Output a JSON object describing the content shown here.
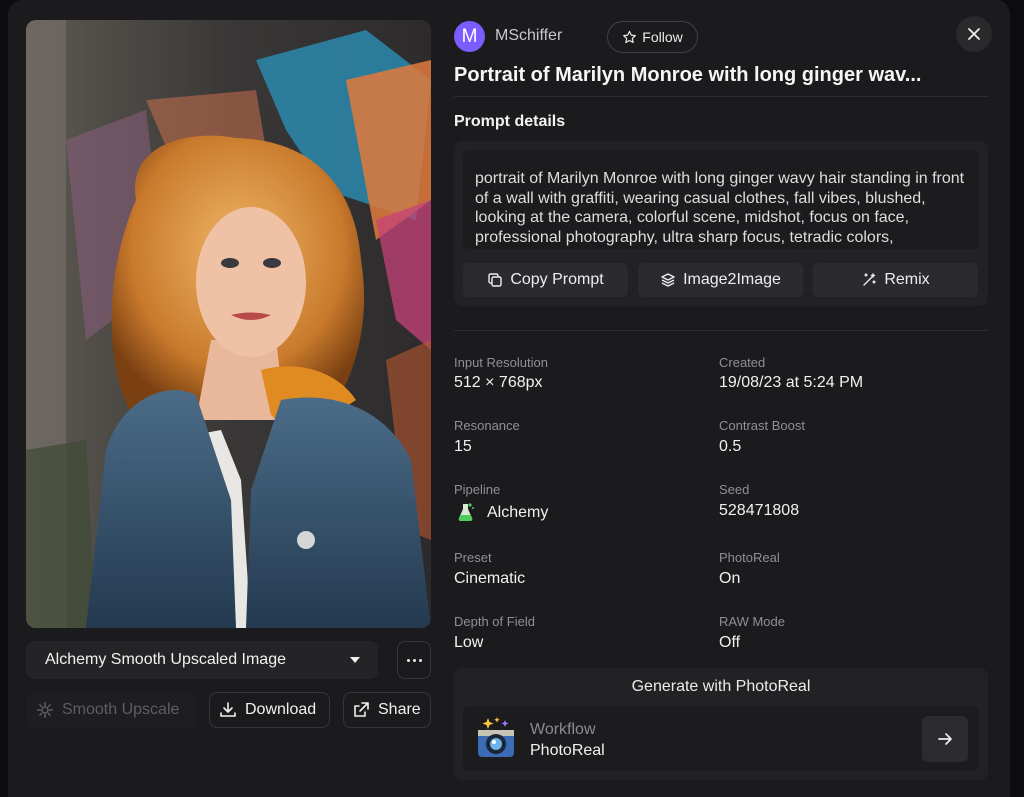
{
  "image": {
    "variant_label": "Alchemy Smooth Upscaled Image"
  },
  "actions": {
    "smooth_upscale": "Smooth Upscale",
    "download": "Download",
    "share": "Share"
  },
  "author": {
    "initial": "M",
    "name": "MSchiffer",
    "follow_label": "Follow"
  },
  "title": "Portrait of Marilyn Monroe with long ginger wav...",
  "prompt": {
    "heading": "Prompt details",
    "text": "portrait of Marilyn Monroe with long ginger wavy hair standing in front of a wall with graffiti, wearing casual clothes, fall vibes, blushed, looking at the camera, colorful scene, midshot, focus on face, professional photography, ultra sharp focus, tetradic colors,",
    "copy_label": "Copy Prompt",
    "img2img_label": "Image2Image",
    "remix_label": "Remix"
  },
  "details": {
    "input_resolution": {
      "label": "Input Resolution",
      "value": "512 × 768px"
    },
    "created": {
      "label": "Created",
      "value": "19/08/23 at 5:24 PM"
    },
    "resonance": {
      "label": "Resonance",
      "value": "15"
    },
    "contrast_boost": {
      "label": "Contrast Boost",
      "value": "0.5"
    },
    "pipeline": {
      "label": "Pipeline",
      "value": "Alchemy"
    },
    "seed": {
      "label": "Seed",
      "value": "528471808"
    },
    "preset": {
      "label": "Preset",
      "value": "Cinematic"
    },
    "photoreal": {
      "label": "PhotoReal",
      "value": "On"
    },
    "depth_of_field": {
      "label": "Depth of Field",
      "value": "Low"
    },
    "raw_mode": {
      "label": "RAW Mode",
      "value": "Off"
    }
  },
  "generate": {
    "title": "Generate with PhotoReal",
    "workflow_label": "Workflow",
    "workflow_value": "PhotoReal"
  },
  "icons": {
    "close": "close-icon",
    "follow": "star-icon",
    "copy": "copy-icon",
    "img2img": "layers-icon",
    "remix": "magic-wand-icon",
    "download": "download-icon",
    "share": "external-link-icon",
    "upscale": "sparkle-icon",
    "pipeline": "potion-icon",
    "workflow": "camera-icon",
    "arrow": "arrow-right-icon"
  },
  "colors": {
    "background": "#1b1b1d",
    "card": "#222225",
    "avatar": "#7b5cff"
  }
}
